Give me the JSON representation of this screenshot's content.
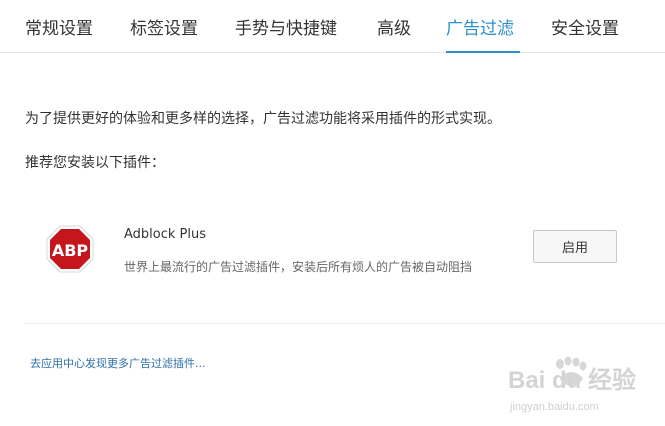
{
  "tabs": [
    {
      "label": "常规设置"
    },
    {
      "label": "标签设置"
    },
    {
      "label": "手势与快捷键"
    },
    {
      "label": "高级"
    },
    {
      "label": "广告过滤"
    },
    {
      "label": "安全设置"
    }
  ],
  "active_tab": "广告过滤",
  "main": {
    "intro_text": "为了提供更好的体验和更多样的选择，广告过滤功能将采用插件的形式实现。",
    "recommend_text": "推荐您安装以下插件："
  },
  "plugin": {
    "logo_text": "ABP",
    "name": "Adblock Plus",
    "description": "世界上最流行的广告过滤插件，安装后所有烦人的广告被自动阻挡",
    "action_label": "启用"
  },
  "footer": {
    "more_link": "去应用中心发现更多广告过滤插件..."
  },
  "watermark": {
    "brand": "Bai du 经验",
    "url": "jingyan.baidu.com"
  },
  "colors": {
    "accent": "#2e8fc9",
    "abp_red": "#c4161c",
    "link": "#2e6fa8"
  },
  "icons": {
    "plugin_logo": "adblock-plus-icon",
    "watermark": "baidu-paw-icon"
  }
}
